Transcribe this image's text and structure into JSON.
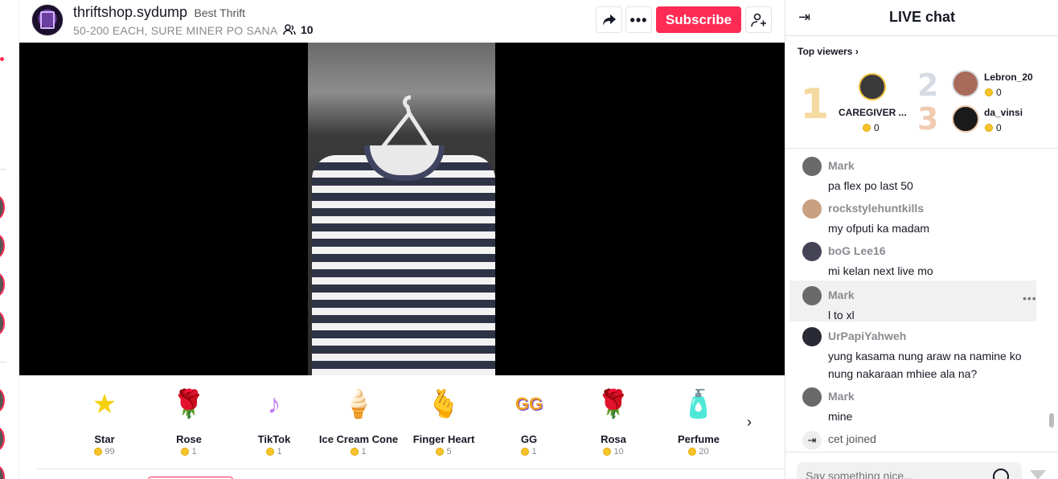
{
  "header": {
    "host_name": "thriftshop.sydump",
    "host_tag": "Best Thrift",
    "description": "50-200 EACH, SURE MINER PO SANA",
    "viewer_count": "10",
    "subscribe_label": "Subscribe"
  },
  "gifts": {
    "items": [
      {
        "name": "Star",
        "price": "99",
        "icon": "★"
      },
      {
        "name": "Rose",
        "price": "1",
        "icon": "🌹"
      },
      {
        "name": "TikTok",
        "price": "1",
        "icon": "♪"
      },
      {
        "name": "Ice Cream Cone",
        "price": "1",
        "icon": "🍦"
      },
      {
        "name": "Finger Heart",
        "price": "5",
        "icon": "🫰"
      },
      {
        "name": "GG",
        "price": "1",
        "icon": "GG"
      },
      {
        "name": "Rosa",
        "price": "10",
        "icon": "🌹"
      },
      {
        "name": "Perfume",
        "price": "20",
        "icon": "🧴"
      }
    ],
    "next_icon": "chevron-right-icon"
  },
  "chat": {
    "title": "LIVE chat",
    "top_viewers_label": "Top viewers",
    "top_viewers": [
      {
        "rank": "1",
        "name": "CAREGIVER ...",
        "coins": "0"
      },
      {
        "rank": "2",
        "name": "Lebron_20",
        "coins": "0"
      },
      {
        "rank": "3",
        "name": "da_vinsi",
        "coins": "0"
      }
    ],
    "messages": [
      {
        "user": "Mark",
        "text": "pa flex po last 50"
      },
      {
        "user": "rockstylehuntkills",
        "text": "my ofputi ka madam"
      },
      {
        "user": "boG Lee16",
        "text": "mi kelan next live mo"
      },
      {
        "user": "Mark",
        "text": "l to xl"
      },
      {
        "user": "UrPapiYahweh",
        "text": "yung kasama nung araw na namine ko nung nakaraan mhiee ala na?"
      },
      {
        "user": "Mark",
        "text": "mine"
      }
    ],
    "join_text": "cet joined",
    "input_placeholder": "Say something nice..."
  },
  "colors": {
    "accent": "#fe2c55",
    "coin": "#f7c52b"
  }
}
